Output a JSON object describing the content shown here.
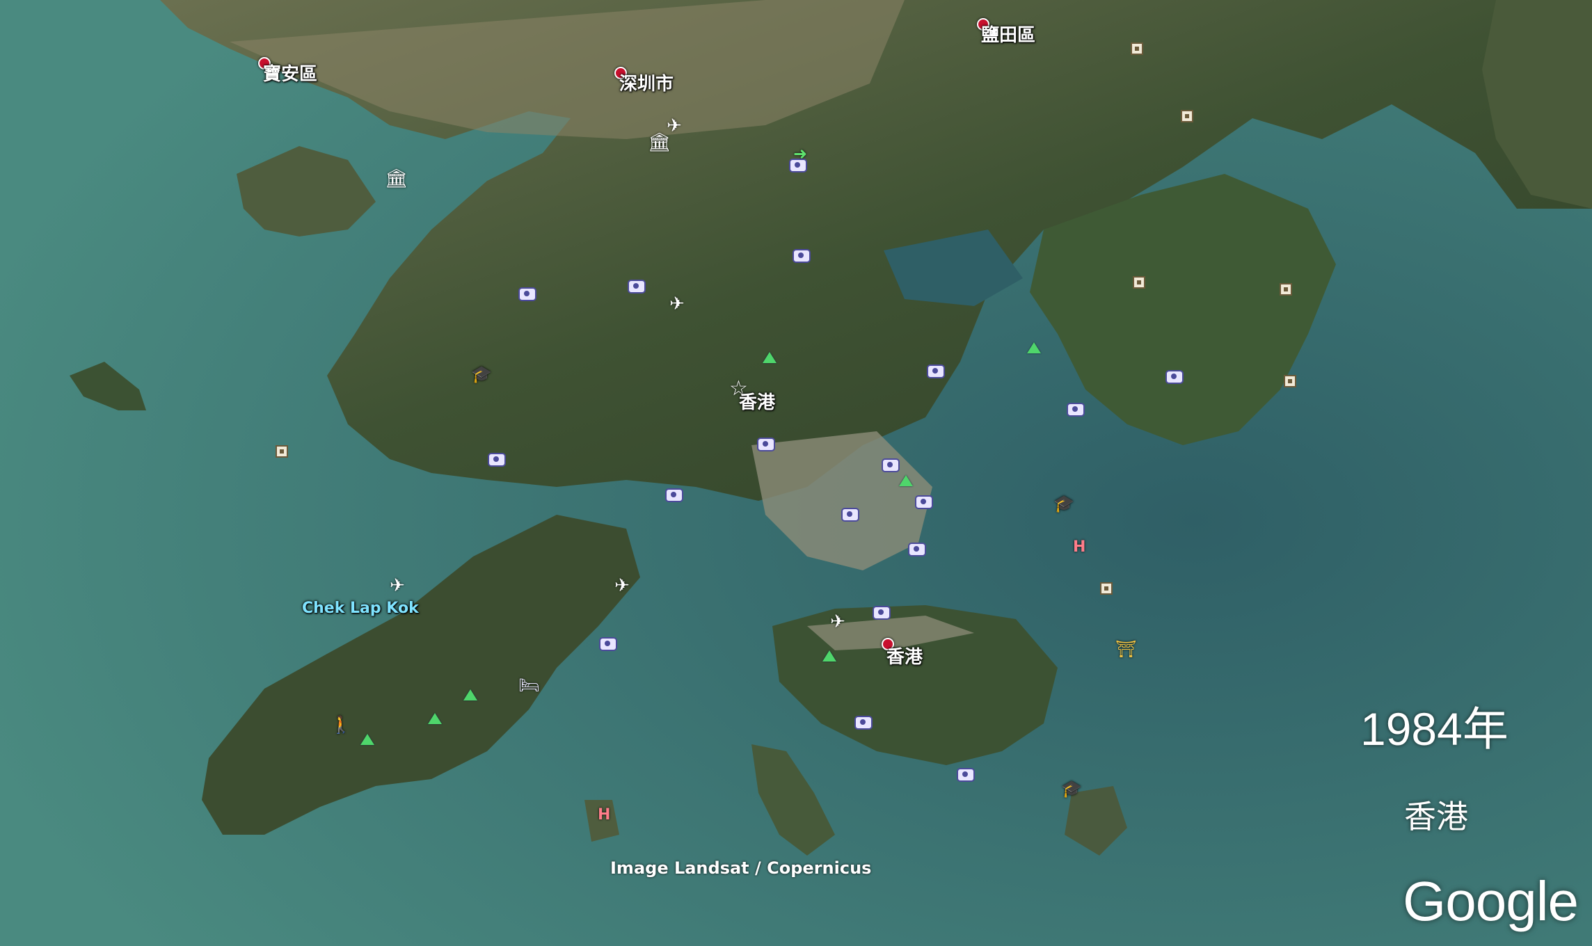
{
  "map": {
    "place_labels": [
      {
        "id": "baoan",
        "text": "寶安區"
      },
      {
        "id": "shenzhen",
        "text": "深圳市"
      },
      {
        "id": "yantian",
        "text": "鹽田區"
      },
      {
        "id": "hongkong_nt",
        "text": "香港"
      },
      {
        "id": "hongkong_island",
        "text": "香港"
      },
      {
        "id": "chek_lap_kok",
        "text": "Chek Lap Kok"
      }
    ],
    "overlay": {
      "year": "1984年",
      "place": "香港",
      "imagery_credit": "Image Landsat / Copernicus",
      "logo": "Google"
    },
    "colors": {
      "sea": "#3f7a78",
      "sea_deep": "#2f5f66",
      "land": "#4a5a3a",
      "land_dark": "#2f3f27",
      "urban": "#8a8a72",
      "pin": "#c8102e"
    },
    "icon_types": [
      "camera-icon",
      "landmark-square-icon",
      "mountain-peak-icon",
      "airport-icon",
      "museum-icon",
      "hospital-icon",
      "school-icon",
      "star-icon",
      "temple-icon",
      "hotel-icon",
      "hiking-icon"
    ]
  }
}
